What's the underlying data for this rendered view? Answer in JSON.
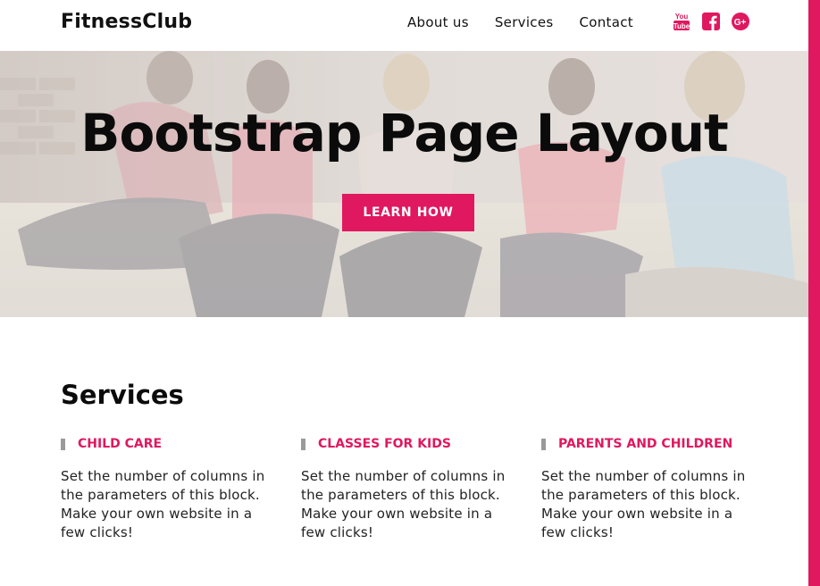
{
  "colors": {
    "accent": "#e0185f",
    "text": "#111111",
    "marker": "#9a9a9a"
  },
  "nav": {
    "brand": "FitnessClub",
    "links": [
      {
        "label": "About us"
      },
      {
        "label": "Services"
      },
      {
        "label": "Contact"
      }
    ],
    "social": [
      {
        "icon": "youtube-icon",
        "text": "You Tube"
      },
      {
        "icon": "facebook-icon",
        "text": "f"
      },
      {
        "icon": "google-plus-icon",
        "text": "G+"
      }
    ]
  },
  "hero": {
    "title": "Bootstrap Page Layout",
    "button_label": "LEARN HOW"
  },
  "services": {
    "title": "Services",
    "items": [
      {
        "label": "CHILD CARE",
        "text": "Set the number of columns in the parameters of this block. Make your own website in a few clicks!"
      },
      {
        "label": "CLASSES FOR KIDS",
        "text": "Set the number of columns in the parameters of this block. Make your own website in a few clicks!"
      },
      {
        "label": "PARENTS AND CHILDREN",
        "text": "Set the number of columns in the parameters of this block. Make your own website in a few clicks!"
      }
    ]
  }
}
